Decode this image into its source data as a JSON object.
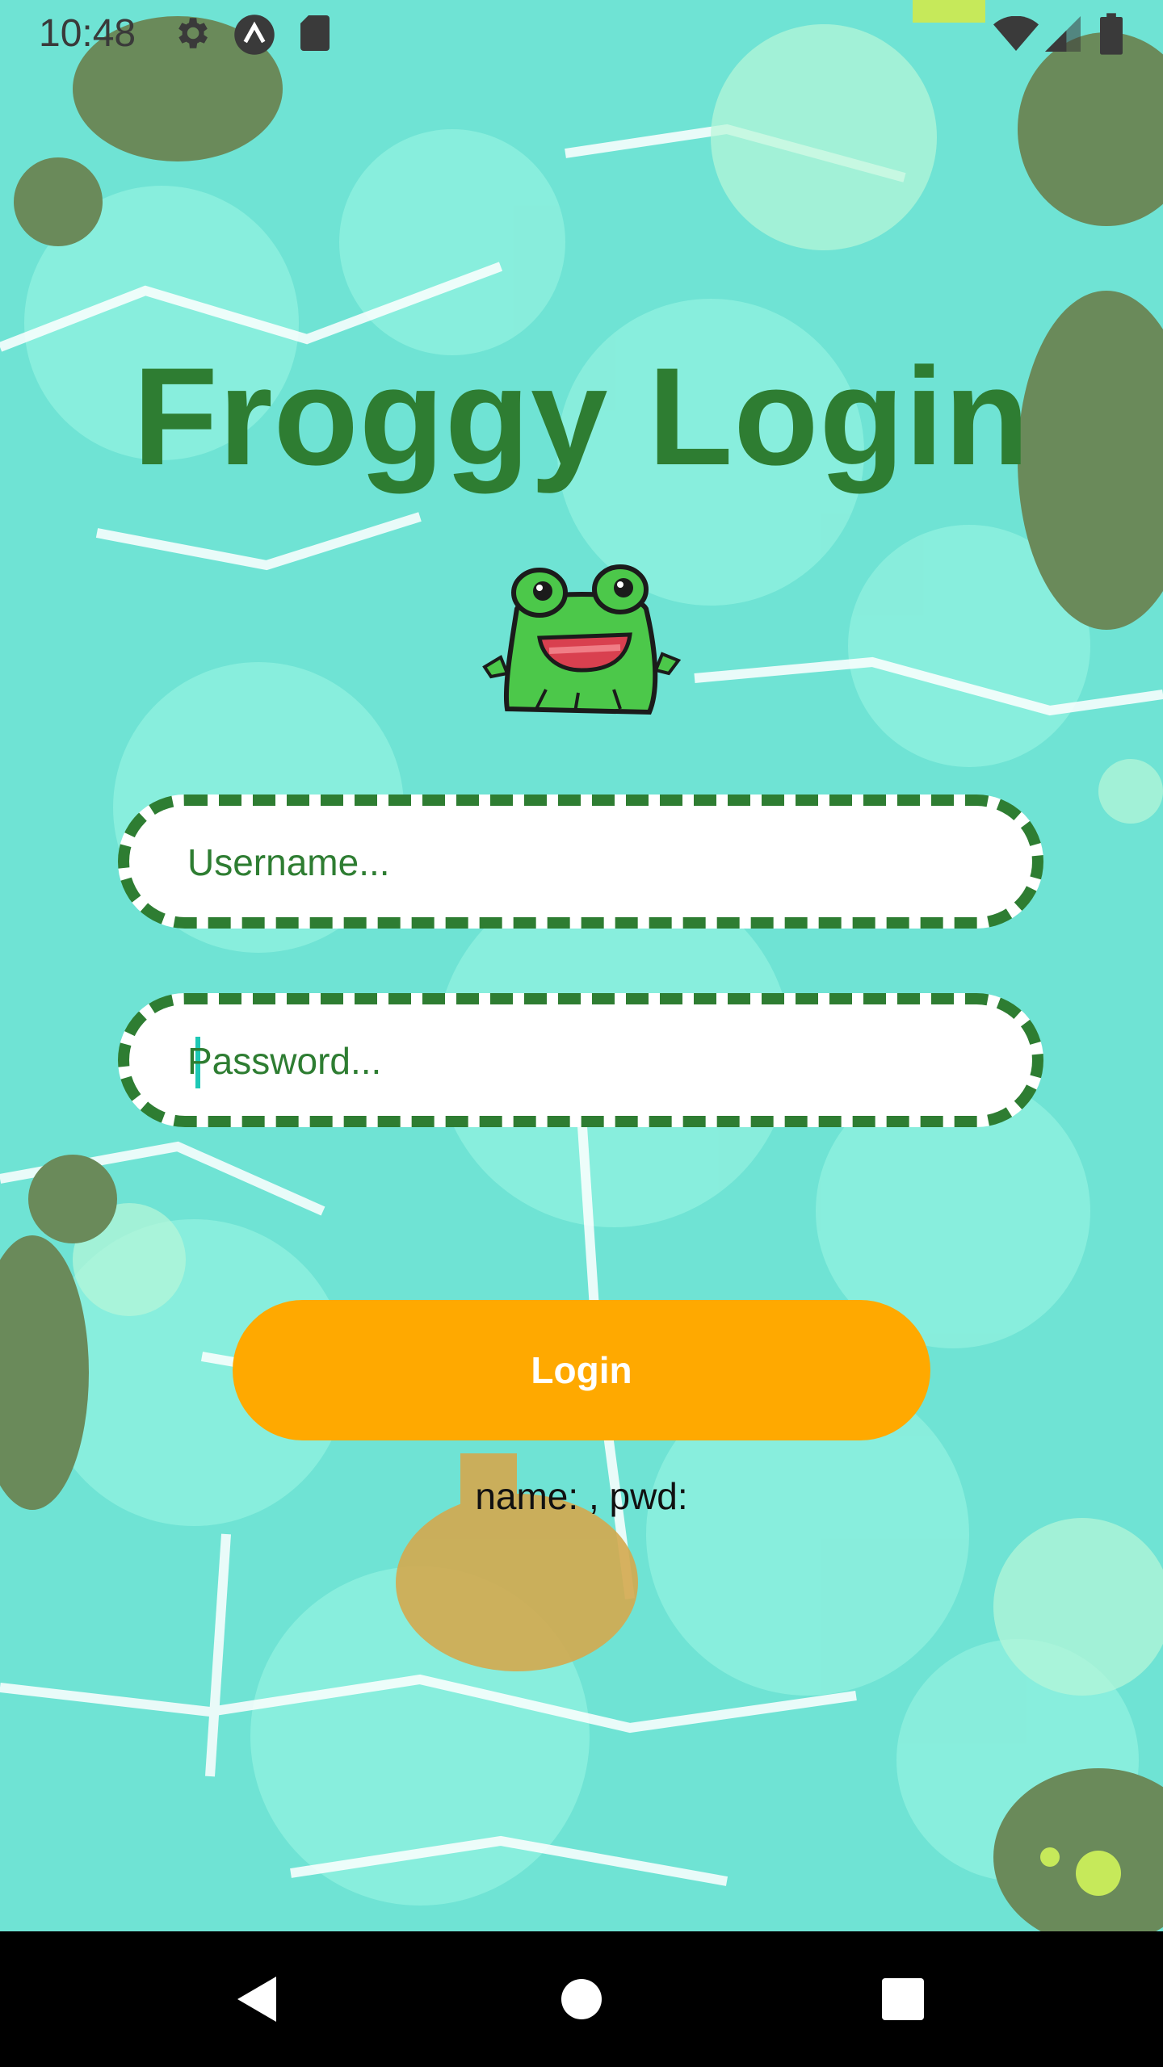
{
  "status_bar": {
    "time": "10:48",
    "icons": [
      "gear-icon",
      "a-letter-icon",
      "sd-card-icon",
      "wifi-icon",
      "signal-icon",
      "battery-icon"
    ]
  },
  "login": {
    "title": "Froggy Login",
    "username_placeholder": "Username...",
    "password_placeholder": "Password...",
    "button_label": "Login",
    "result_text": "name: , pwd:"
  },
  "nav_bar": {
    "buttons": [
      "back-icon",
      "home-icon",
      "recents-icon"
    ]
  },
  "colors": {
    "title": "#2e7d32",
    "field_border": "#2e7d32",
    "button": "#ffa900",
    "water": "#6fe3d4",
    "lily_pad": "#6a8a5a"
  }
}
